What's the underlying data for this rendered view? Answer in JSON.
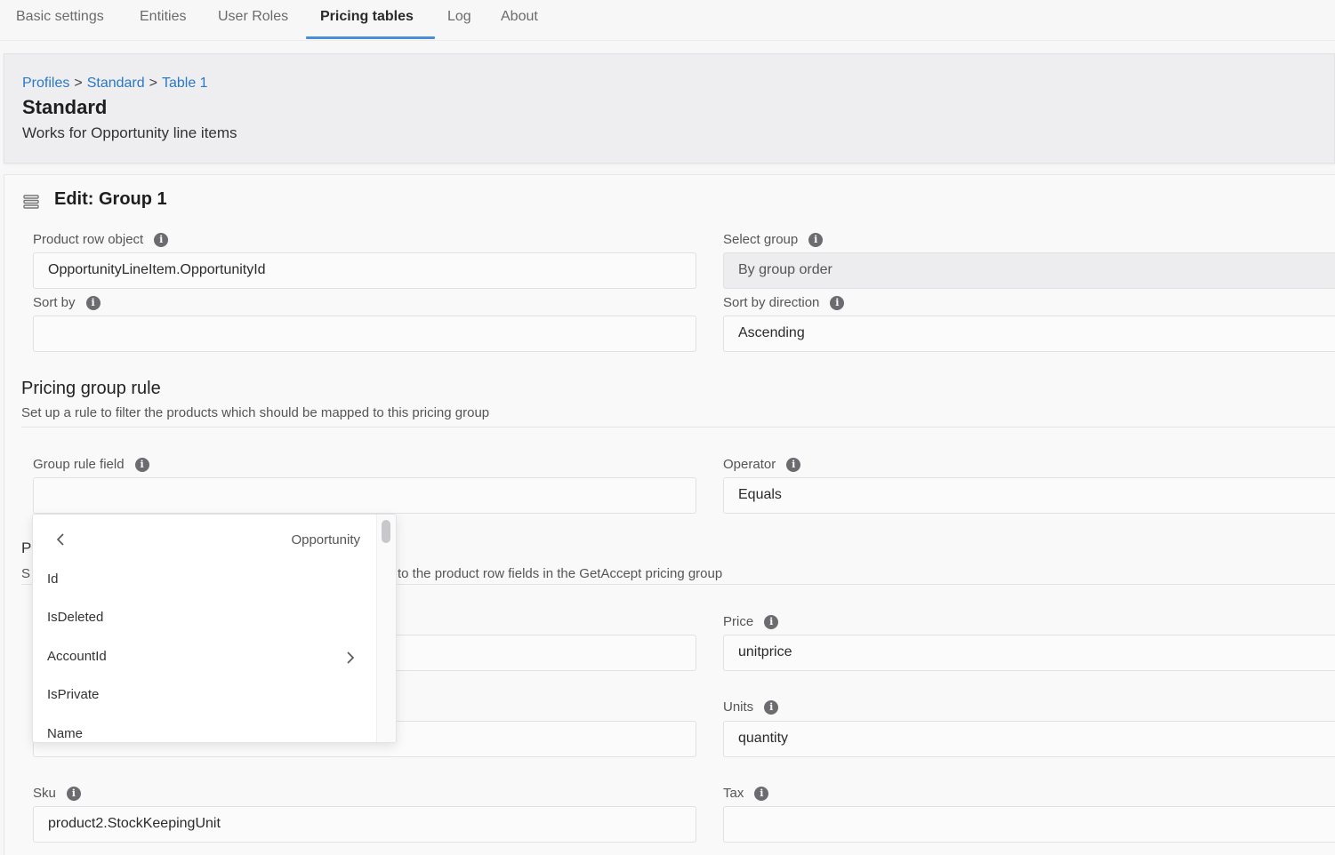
{
  "tabs": [
    {
      "label": "Basic settings"
    },
    {
      "label": "Entities"
    },
    {
      "label": "User Roles"
    },
    {
      "label": "Pricing tables"
    },
    {
      "label": "Log"
    },
    {
      "label": "About"
    }
  ],
  "active_tab": "Pricing tables",
  "breadcrumb": [
    "Profiles",
    "Standard",
    "Table 1"
  ],
  "breadcrumb_sep": ">",
  "header": {
    "title": "Standard",
    "subtitle": "Works for Opportunity line items"
  },
  "edit": {
    "title": "Edit: Group 1",
    "product_row_object_label": "Product row object",
    "product_row_object_value": "OpportunityLineItem.OpportunityId",
    "select_group_label": "Select group",
    "select_group_value": "By group order",
    "sort_by_label": "Sort by",
    "sort_by_value": "",
    "sort_dir_label": "Sort by direction",
    "sort_dir_value": "Ascending"
  },
  "rule": {
    "title": "Pricing group rule",
    "desc": "Set up a rule to filter the products which should be mapped to this pricing group",
    "field_label": "Group rule field",
    "field_value": "",
    "operator_label": "Operator",
    "operator_value": "Equals"
  },
  "mapping": {
    "title_peek": "P",
    "desc_peek": "S",
    "desc_visible": "to the product row fields in the GetAccept pricing group",
    "price_label": "Price",
    "price_value": "unitprice",
    "units_label": "Units",
    "units_value": "quantity",
    "sku_label": "Sku",
    "sku_value": "product2.StockKeepingUnit",
    "tax_label": "Tax",
    "tax_value": ""
  },
  "dropdown": {
    "title": "Opportunity",
    "items": [
      "Id",
      "IsDeleted",
      "AccountId",
      "IsPrivate",
      "Name"
    ],
    "item_with_submenu": "AccountId"
  },
  "icons": {
    "info": "info-icon",
    "edit": "list-icon",
    "back": "chevron-left-icon",
    "forward": "chevron-right-icon"
  },
  "colors": {
    "link": "#2a78c8",
    "tab_underline": "#4a8fd6"
  }
}
